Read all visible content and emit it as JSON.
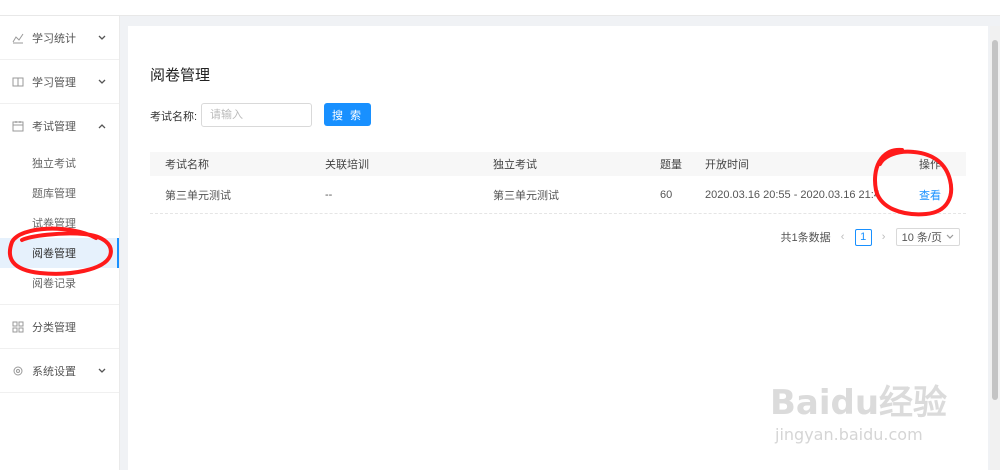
{
  "sidebar": {
    "groups": [
      {
        "label": "学习统计",
        "icon": "line-chart-icon",
        "expanded": false
      },
      {
        "label": "学习管理",
        "icon": "book-icon",
        "expanded": false
      },
      {
        "label": "考试管理",
        "icon": "calendar-icon",
        "expanded": true
      },
      {
        "label": "分类管理",
        "icon": "grid-icon",
        "expanded": false
      },
      {
        "label": "系统设置",
        "icon": "gear-icon",
        "expanded": false
      }
    ],
    "exam_sub_items": [
      {
        "label": "独立考试"
      },
      {
        "label": "题库管理"
      },
      {
        "label": "试卷管理"
      },
      {
        "label": "阅卷管理",
        "active": true
      },
      {
        "label": "阅卷记录"
      }
    ]
  },
  "page": {
    "title": "阅卷管理"
  },
  "filter": {
    "label": "考试名称:",
    "placeholder": "请输入",
    "search_label": "搜 索"
  },
  "table": {
    "headers": [
      "考试名称",
      "关联培训",
      "独立考试",
      "题量",
      "开放时间",
      "操作"
    ],
    "rows": [
      {
        "exam_name": "第三单元测试",
        "training": "--",
        "independent_exam": "第三单元测试",
        "question_count": "60",
        "open_time": "2020.03.16 20:55 - 2020.03.16 21:4",
        "action": "查看"
      }
    ]
  },
  "pagination": {
    "total": "共1条数据",
    "current_page": "1",
    "page_size": "10 条/页"
  },
  "colors": {
    "accent": "#1890ff",
    "annotation": "#ff1a1a",
    "active_bg": "#e6f1fc"
  },
  "watermark": {
    "main": "Baidu经验",
    "sub": "jingyan.baidu.com"
  }
}
